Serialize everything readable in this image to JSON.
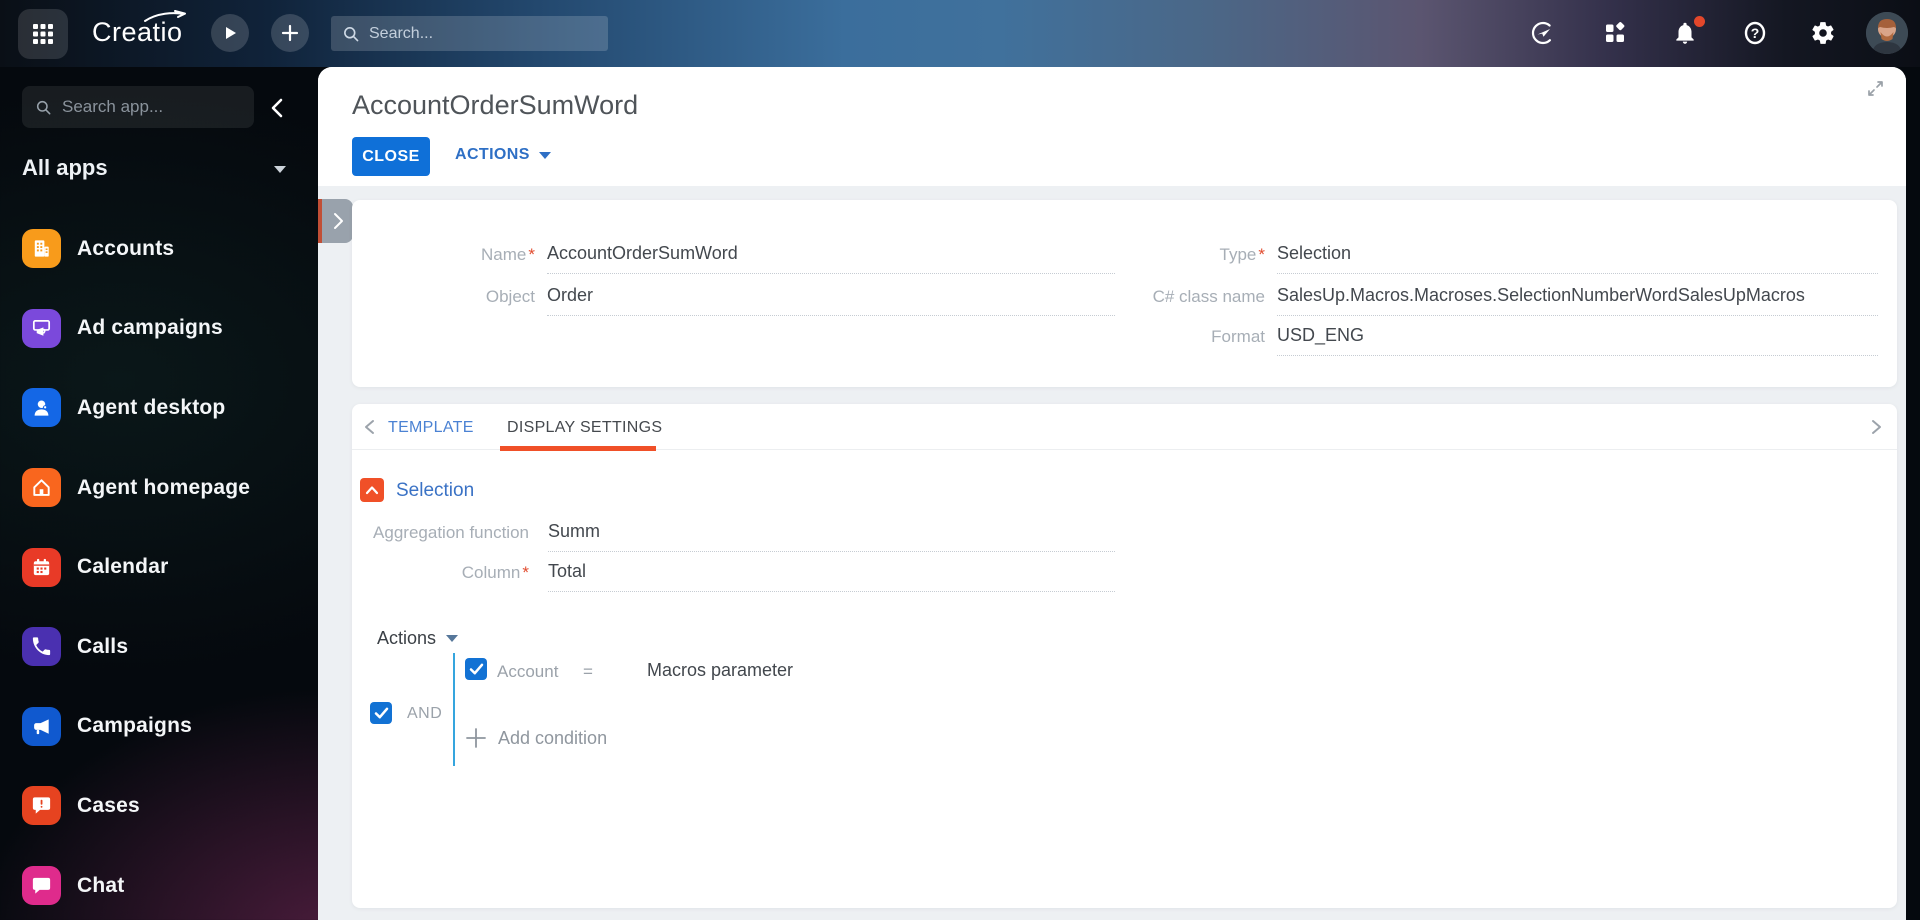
{
  "topbar": {
    "logo": "Creatio",
    "search_placeholder": "Search..."
  },
  "sidebar": {
    "search_placeholder": "Search app...",
    "section_label": "All apps",
    "apps": [
      {
        "label": "Accounts",
        "icon": "building",
        "color": "#f89b1b"
      },
      {
        "label": "Ad campaigns",
        "icon": "screen-megaphone",
        "color": "#7b49db"
      },
      {
        "label": "Agent desktop",
        "icon": "person",
        "color": "#1467e6"
      },
      {
        "label": "Agent homepage",
        "icon": "home",
        "color": "#f9661e"
      },
      {
        "label": "Calendar",
        "icon": "calendar",
        "color": "#e83a27"
      },
      {
        "label": "Calls",
        "icon": "phone",
        "color": "#4a30b0"
      },
      {
        "label": "Campaigns",
        "icon": "megaphone",
        "color": "#1059cf"
      },
      {
        "label": "Cases",
        "icon": "case-bubble",
        "color": "#e64320"
      },
      {
        "label": "Chat",
        "icon": "chat-bubble",
        "color": "#df2b8c"
      }
    ]
  },
  "main": {
    "title": "AccountOrderSumWord",
    "close_label": "CLOSE",
    "actions_label": "ACTIONS"
  },
  "form": {
    "name": {
      "label": "Name",
      "required": "*",
      "value": "AccountOrderSumWord"
    },
    "object": {
      "label": "Object",
      "value": "Order"
    },
    "type": {
      "label": "Type",
      "required": "*",
      "value": "Selection"
    },
    "csharp": {
      "label": "C# class name",
      "value": "SalesUp.Macros.Macroses.SelectionNumberWordSalesUpMacros"
    },
    "format": {
      "label": "Format",
      "value": "USD_ENG"
    }
  },
  "tabs": {
    "items": [
      {
        "label": "TEMPLATE",
        "active": false
      },
      {
        "label": "DISPLAY SETTINGS",
        "active": true
      }
    ]
  },
  "display_settings": {
    "section_title": "Selection",
    "aggregation": {
      "label": "Aggregation function",
      "value": "Summ"
    },
    "column": {
      "label": "Column",
      "required": "*",
      "value": "Total"
    },
    "filter": {
      "actions_label": "Actions",
      "logical_operator": "AND",
      "conditions": [
        {
          "field": "Account",
          "operator": "=",
          "value": "Macros parameter",
          "checked": true
        }
      ],
      "add_condition_label": "Add condition"
    }
  },
  "colors": {
    "primary_button": "#0f70d8",
    "checkbox_blue": "#1272d4",
    "tab_active_underline": "#f05028",
    "section_icon": "#f05028",
    "notification_badge": "#e3472b",
    "filter_connector_line": "#35a5de",
    "link_blue": "#2e6fc5"
  }
}
